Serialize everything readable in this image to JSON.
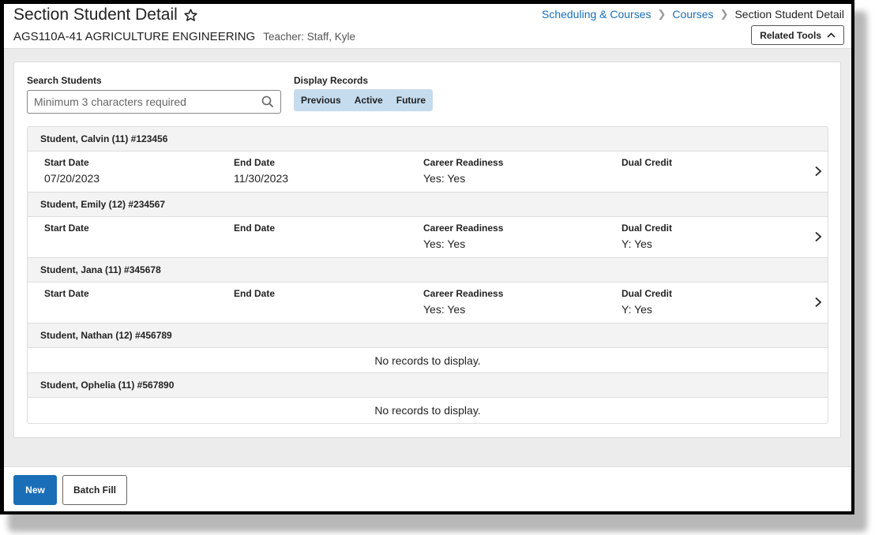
{
  "header": {
    "title": "Section Student Detail",
    "section": "AGS110A-41 AGRICULTURE ENGINEERING",
    "teacher": "Teacher: Staff, Kyle",
    "breadcrumb": [
      "Scheduling & Courses",
      "Courses",
      "Section Student Detail"
    ],
    "related_tools": "Related Tools"
  },
  "search": {
    "label": "Search Students",
    "placeholder": "Minimum 3 characters required"
  },
  "display_records": {
    "label": "Display Records",
    "options": [
      "Previous",
      "Active",
      "Future"
    ]
  },
  "field_labels": {
    "start": "Start Date",
    "end": "End Date",
    "career": "Career Readiness",
    "dual": "Dual Credit"
  },
  "empty_message": "No records to display.",
  "students": [
    {
      "name": "Student, Calvin (11) #123456",
      "start": "07/20/2023",
      "end": "11/30/2023",
      "career": "Yes: Yes",
      "dual": ""
    },
    {
      "name": "Student, Emily (12) #234567",
      "start": "",
      "end": "",
      "career": "Yes: Yes",
      "dual": "Y: Yes"
    },
    {
      "name": "Student, Jana (11) #345678",
      "start": "",
      "end": "",
      "career": "Yes: Yes",
      "dual": "Y: Yes"
    },
    {
      "name": "Student, Nathan (12) #456789"
    },
    {
      "name": "Student, Ophelia (11) #567890"
    }
  ],
  "footer": {
    "new_label": "New",
    "batch_fill_label": "Batch Fill"
  },
  "colors": {
    "link": "#1a6eb8",
    "primary_button": "#1a6eb8",
    "toggle_bg": "#c5dcee"
  }
}
